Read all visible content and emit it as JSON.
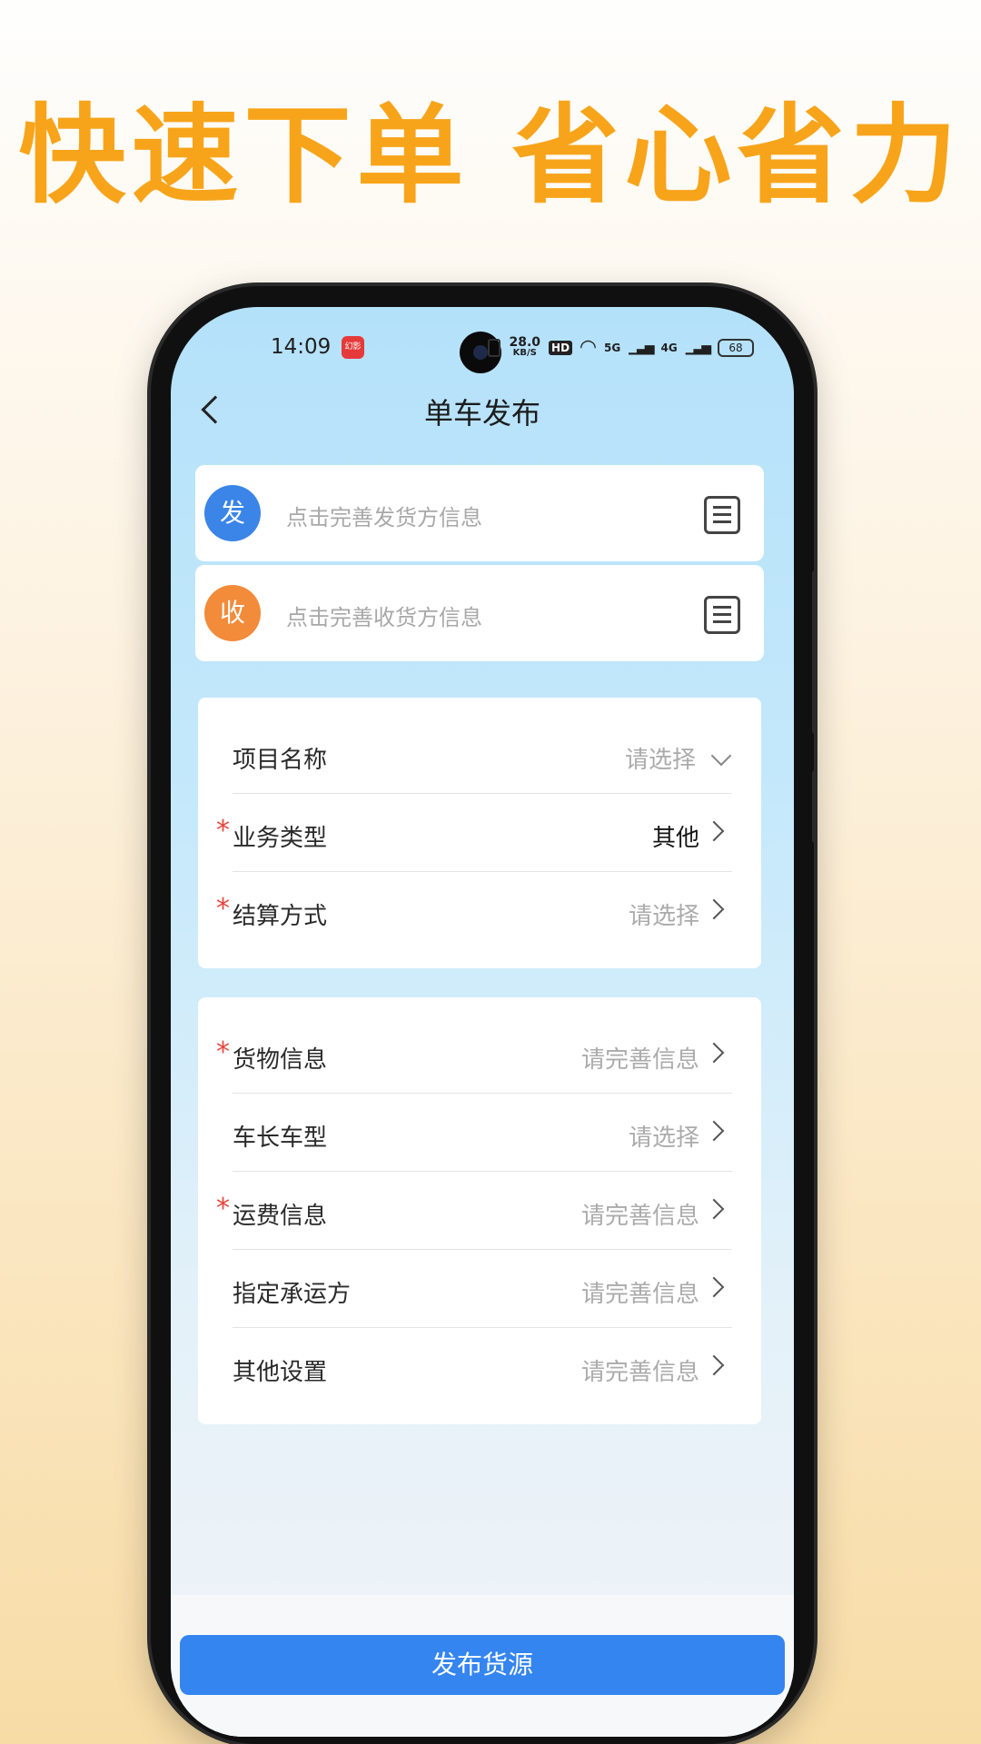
{
  "headline": "快速下单 省心省力",
  "status_bar": {
    "time": "14:09",
    "app_badge": "幻影",
    "net_speed": "28.0",
    "net_speed_unit": "KB/S",
    "hd": "HD",
    "signal_1": "5G",
    "signal_2": "4G",
    "battery": "68"
  },
  "nav": {
    "back_icon": "chevron-left-icon",
    "title": "单车发布"
  },
  "sender": {
    "badge": "发",
    "placeholder": "点击完善发货方信息",
    "badge_color": "#3b84e8"
  },
  "receiver": {
    "badge": "收",
    "placeholder": "点击完善收货方信息",
    "badge_color": "#f28b3a"
  },
  "section1": {
    "rows": [
      {
        "label": "项目名称",
        "value": "请选择",
        "required": false
      },
      {
        "label": "业务类型",
        "value": "其他",
        "required": true
      },
      {
        "label": "结算方式",
        "value": "请选择",
        "required": true
      }
    ]
  },
  "section2": {
    "rows": [
      {
        "label": "货物信息",
        "value": "请完善信息",
        "required": true
      },
      {
        "label": "车长车型",
        "value": "请选择",
        "required": false
      },
      {
        "label": "运费信息",
        "value": "请完善信息",
        "required": true
      },
      {
        "label": "指定承运方",
        "value": "请完善信息",
        "required": false
      },
      {
        "label": "其他设置",
        "value": "请完善信息",
        "required": false
      }
    ]
  },
  "required_mark": "*",
  "publish_button": "发布货源",
  "colors": {
    "headline": "#f8a41a",
    "primary": "#3485f0",
    "required": "#e8453c"
  }
}
